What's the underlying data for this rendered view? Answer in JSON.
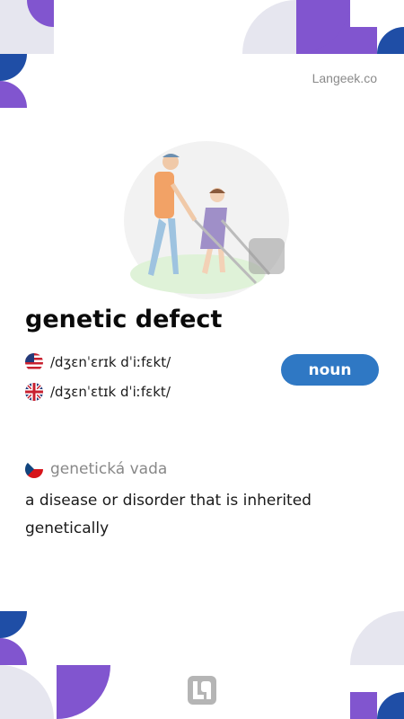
{
  "brand": {
    "text": "Langeek.co"
  },
  "entry": {
    "word": "genetic defect",
    "part_of_speech": "noun",
    "pronunciations": [
      {
        "accent": "us",
        "flag_icon": "us-flag-icon",
        "ipa": "/dʒɛnˈɛrɪk dˈiːfɛkt/"
      },
      {
        "accent": "uk",
        "flag_icon": "uk-flag-icon",
        "ipa": "/dʒɛnˈɛtɪk dˈiːfɛkt/"
      }
    ],
    "translation": {
      "flag_icon": "czech-flag-icon",
      "text": "genetická vada"
    },
    "definition": "a disease or disorder that is inherited genetically"
  },
  "colors": {
    "purple": "#8155cf",
    "blue": "#1f4ea6",
    "grey": "#e6e6ef",
    "noun_badge": "#2f78c4"
  }
}
